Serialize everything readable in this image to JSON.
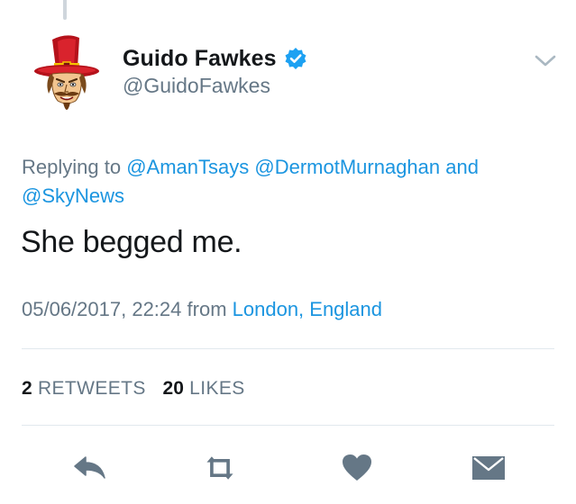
{
  "colors": {
    "link": "#1b95e0",
    "secondary_text": "#657786",
    "primary_text": "#14171a",
    "icon": "#657786",
    "verified_badge": "#1da1f2"
  },
  "author": {
    "display_name": "Guido Fawkes",
    "handle": "@GuidoFawkes",
    "verified": true,
    "avatar_icon": "guido-fawkes-avatar",
    "menu_icon": "chevron-down-icon"
  },
  "reply_context": {
    "prefix": "Replying to",
    "mentions": [
      "@AmanTsays",
      "@DermotMurnaghan"
    ],
    "conjunction": "and",
    "last_mention": "@SkyNews"
  },
  "tweet": {
    "text": "She begged me.",
    "timestamp": "05/06/2017, 22:24",
    "from_label": "from",
    "location": "London, England"
  },
  "stats": {
    "retweets_count": "2",
    "retweets_label": "RETWEETS",
    "likes_count": "20",
    "likes_label": "LIKES"
  },
  "actions": [
    {
      "name": "reply",
      "icon": "reply-icon"
    },
    {
      "name": "retweet",
      "icon": "retweet-icon"
    },
    {
      "name": "like",
      "icon": "heart-icon"
    },
    {
      "name": "direct-message",
      "icon": "envelope-icon"
    }
  ]
}
